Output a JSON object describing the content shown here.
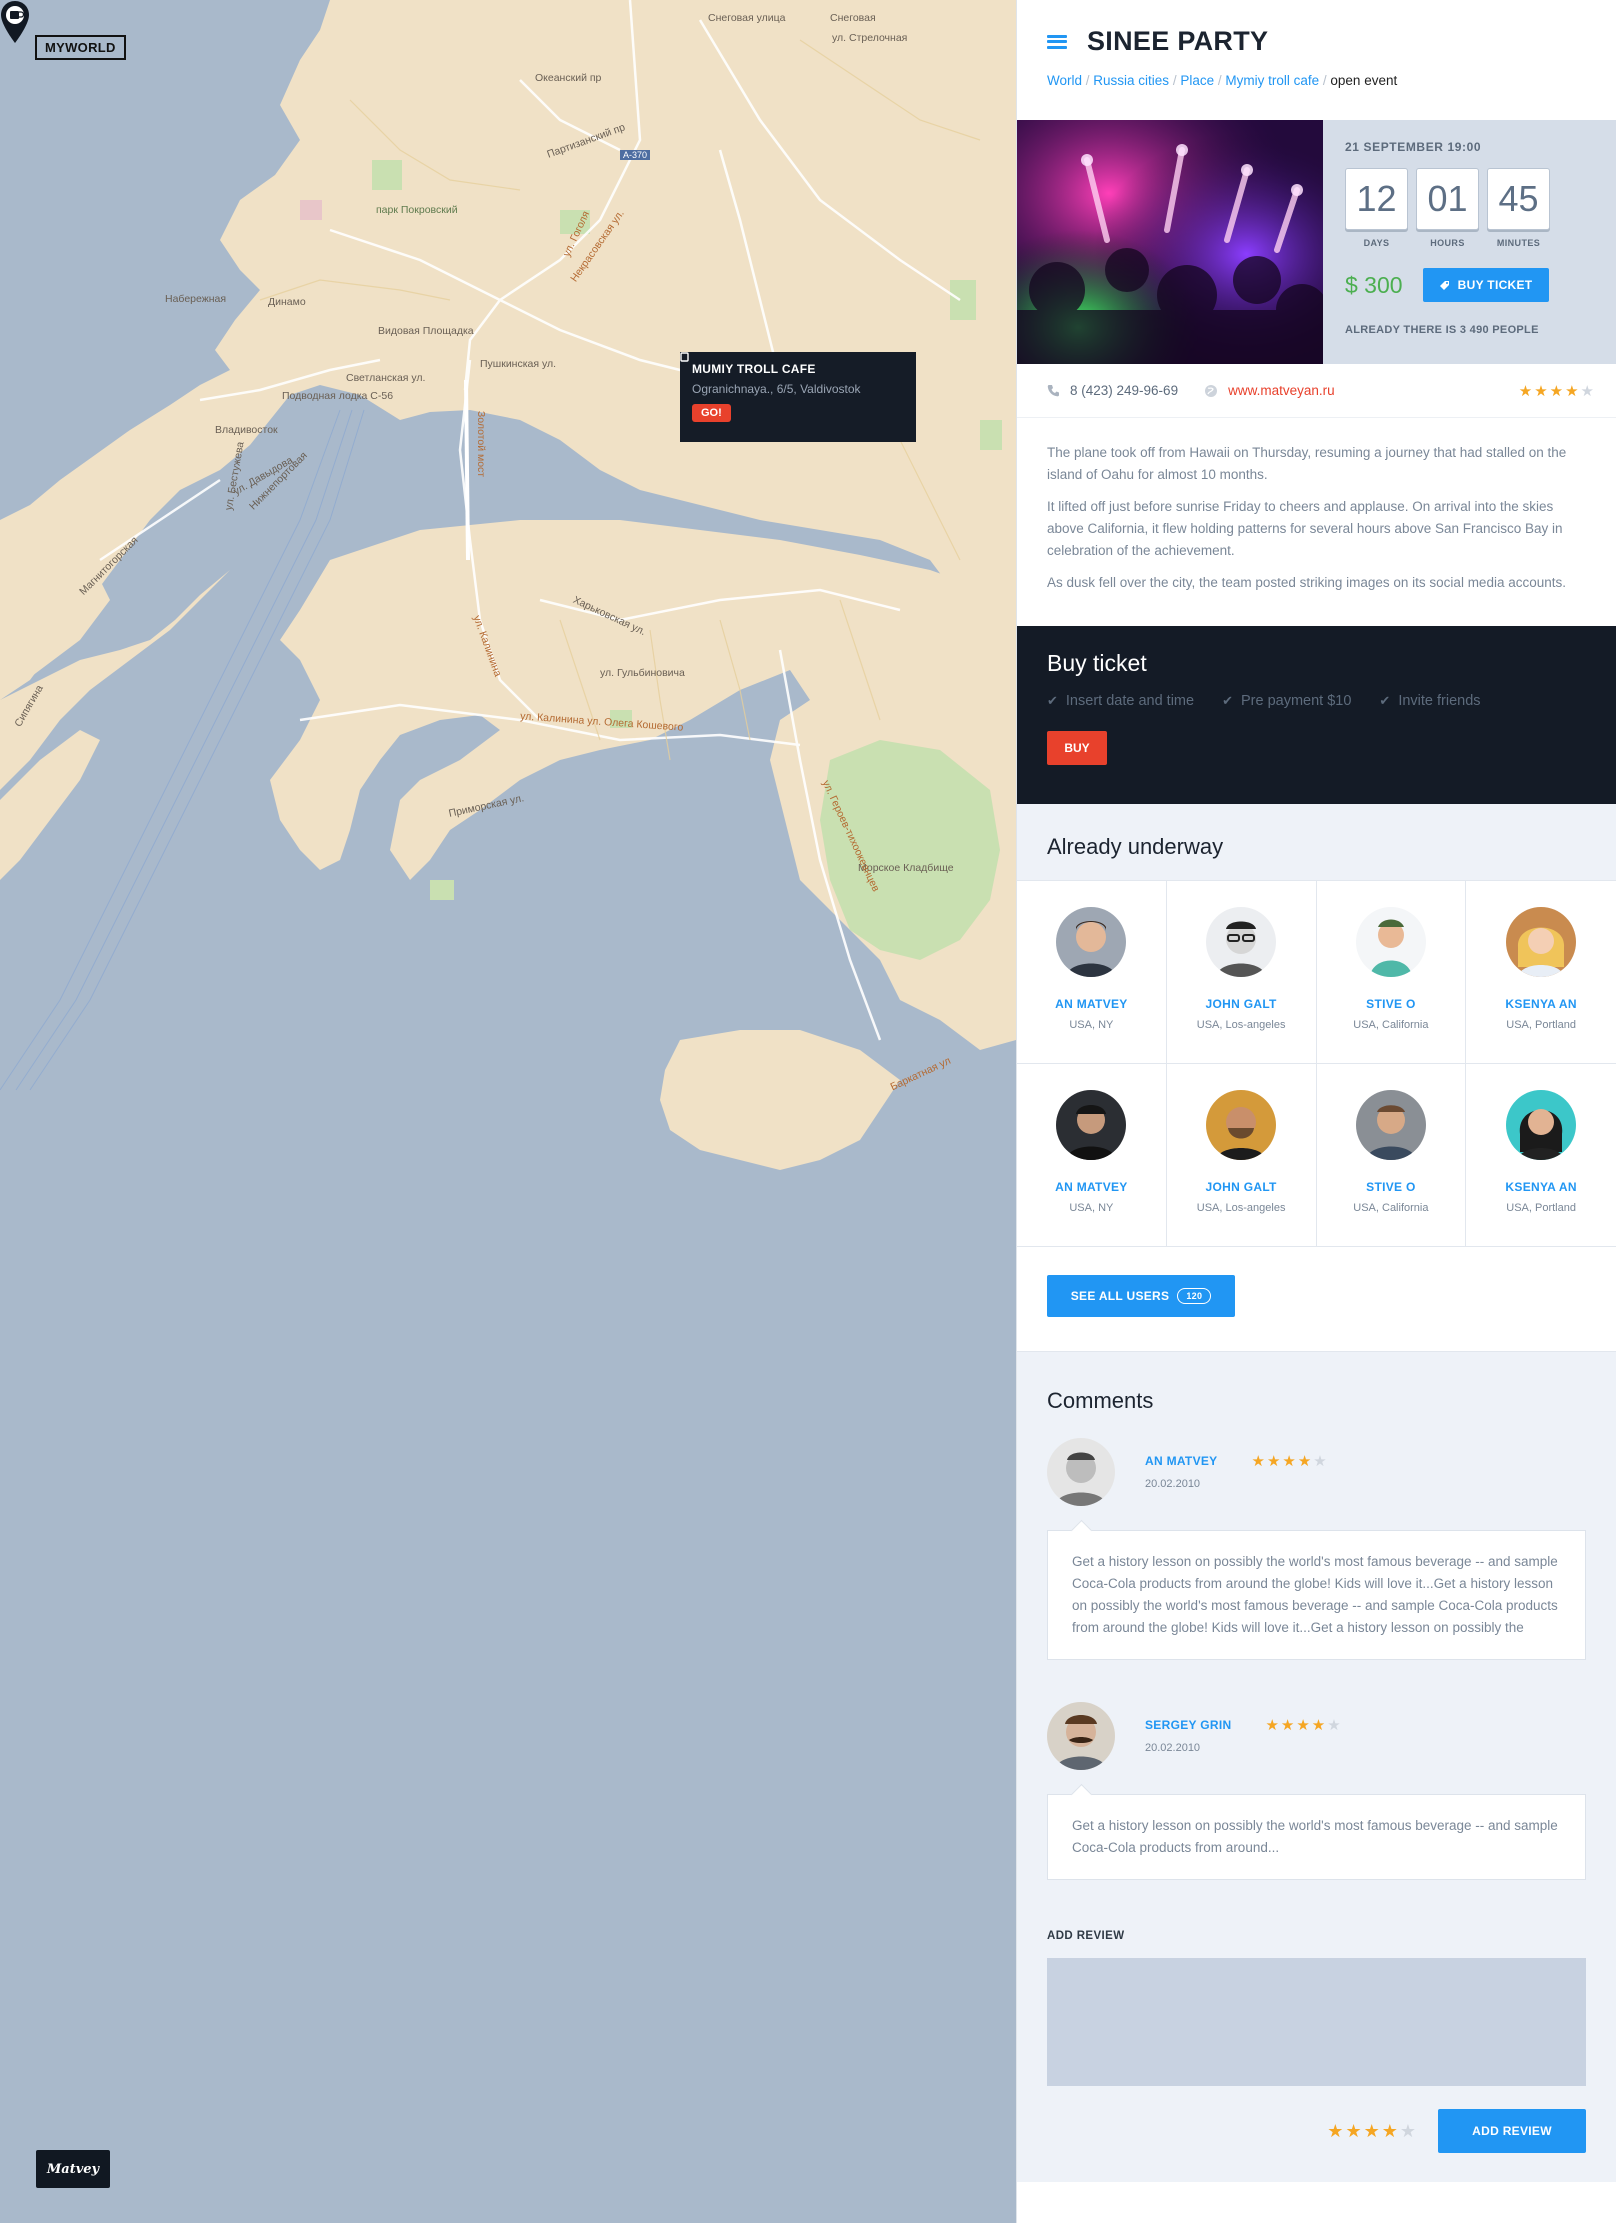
{
  "brand": {
    "logo": "MYWORLD",
    "signature": "Matvey"
  },
  "map": {
    "labels": [
      "Набережная",
      "Динамо",
      "Видовая Площадка",
      "Подводная лодка С-56",
      "Владивосток",
      "Пушкинская ул.",
      "Светланская ул.",
      "Золотой мост",
      "парк Покровский",
      "ул. Гоголя",
      "Некрасовская ул.",
      "Партизанский пр",
      "ул. Калинина",
      "Харьковская ул.",
      "ул. Гульбиновича",
      "ул. Калинина ул. Олега Кошевого",
      "Приморская ул.",
      "Морское Кладбище",
      "Баркатная ул",
      "Снеговая улица",
      "Океанский пр",
      "A-370",
      "Сипягина",
      "Магнитогорская",
      "ул. Давыдова",
      "ул. Бестужева",
      "Нижнепортовая",
      "ул. Героев-тихоокеанцев",
      "Снеговая",
      "ул. Стрелочная"
    ],
    "popup": {
      "title": "MUMIY TROLL CAFE",
      "address": "Ogranichnaya., 6/5, Valdivostok",
      "go_label": "GO!"
    }
  },
  "header": {
    "title": "SINEE PARTY",
    "breadcrumbs": [
      "World",
      "Russia cities",
      "Place",
      "Mymiy troll cafe"
    ],
    "breadcrumb_current": "open event"
  },
  "event": {
    "date": "21 SEPTEMBER 19:00",
    "timer": [
      {
        "value": "12",
        "label": "DAYS"
      },
      {
        "value": "01",
        "label": "HOURS"
      },
      {
        "value": "45",
        "label": "MINUTES"
      }
    ],
    "price": "$ 300",
    "buy_label": "BUY TICKET",
    "already": "ALREADY THERE IS 3 490 PEOPLE",
    "phone": "8 (423) 249-96-69",
    "website": "www.matveyan.ru",
    "rating": 4
  },
  "description": [
    "The plane took off from Hawaii on Thursday, resuming a journey that had stalled on the island of Oahu for almost 10 months.",
    "It lifted off just before sunrise Friday to cheers and applause. On arrival into the skies above California, it flew holding patterns for several hours above San Francisco Bay in celebration of the achievement.",
    "As dusk fell over the city, the team posted striking images on its social media accounts."
  ],
  "buy_block": {
    "title": "Buy ticket",
    "steps": [
      "Insert date and time",
      "Pre payment $10",
      "Invite friends"
    ],
    "button": "BUY"
  },
  "underway": {
    "title": "Already underway",
    "users": [
      {
        "name": "AN MATVEY",
        "location": "USA, NY"
      },
      {
        "name": "JOHN GALT",
        "location": "USA, Los-angeles"
      },
      {
        "name": "STIVE O",
        "location": "USA, California"
      },
      {
        "name": "KSENYA AN",
        "location": "USA, Portland"
      },
      {
        "name": "AN MATVEY",
        "location": "USA, NY"
      },
      {
        "name": "JOHN GALT",
        "location": "USA, Los-angeles"
      },
      {
        "name": "STIVE O",
        "location": "USA, California"
      },
      {
        "name": "KSENYA AN",
        "location": "USA, Portland"
      }
    ],
    "see_all_label": "SEE ALL USERS",
    "see_all_count": "120"
  },
  "comments": {
    "title": "Comments",
    "items": [
      {
        "author": "AN MATVEY",
        "date": "20.02.2010",
        "rating": 4,
        "text": "Get a history lesson on possibly the world's most famous beverage -- and sample Coca-Cola products from around the globe! Kids will love it...Get a history lesson on possibly the world's most famous beverage -- and sample Coca-Cola products from around the globe! Kids will love it...Get a history lesson on possibly the"
      },
      {
        "author": "SERGEY GRIN",
        "date": "20.02.2010",
        "rating": 4,
        "text": "Get a history lesson on possibly the world's most famous beverage -- and sample Coca-Cola products from around..."
      }
    ],
    "add_review_label": "ADD REVIEW",
    "add_review_rating": 4,
    "add_review_button": "ADD REVIEW"
  },
  "colors": {
    "accent": "#2196f3",
    "danger": "#e8412c",
    "dark": "#141b26",
    "price": "#4caf50",
    "star": "#f5a623",
    "water": "#a9b9cb",
    "land": "#f0e1c6",
    "park": "#c9e0b1"
  }
}
